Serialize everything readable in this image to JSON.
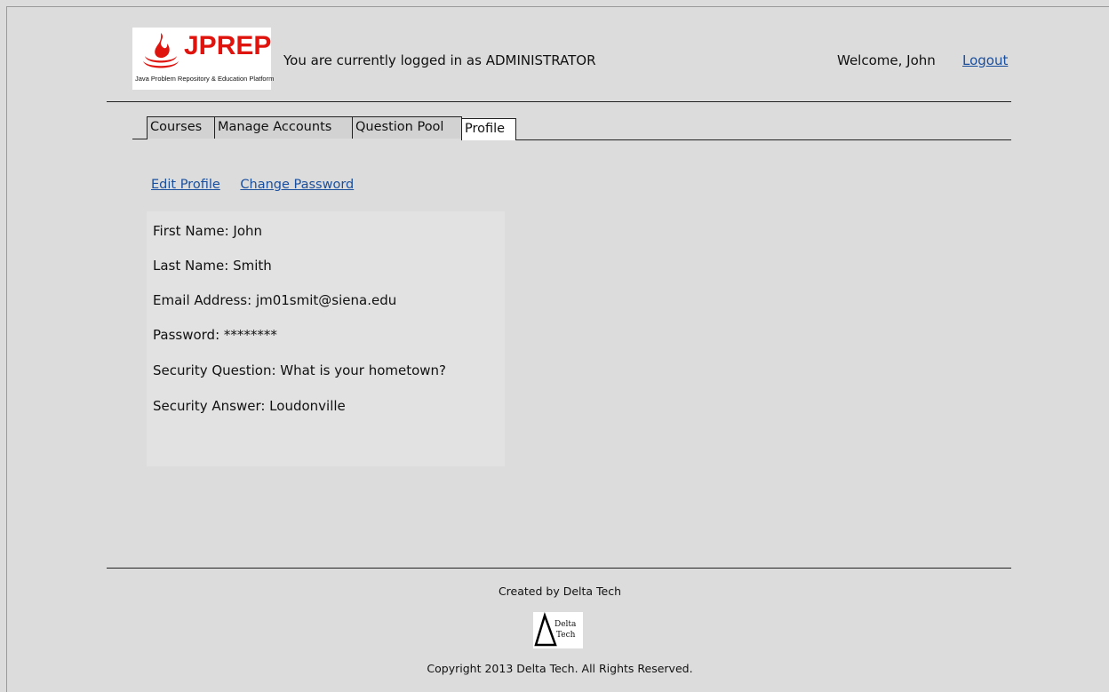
{
  "header": {
    "logo_title": "JPREP",
    "logo_tagline": "Java Problem Repository & Education Platform",
    "logged_in_text": "You are currently logged in as ADMINISTRATOR",
    "welcome_text": "Welcome, John",
    "logout_label": "Logout"
  },
  "tabs": [
    {
      "label": "Courses",
      "active": false
    },
    {
      "label": "Manage Accounts",
      "active": false
    },
    {
      "label": "Question Pool",
      "active": false
    },
    {
      "label": "Profile",
      "active": true
    }
  ],
  "profile_links": {
    "edit_profile": "Edit Profile",
    "change_password": "Change Password"
  },
  "profile": {
    "first_name": "First Name: John",
    "last_name": "Last Name: Smith",
    "email": "Email Address: jm01smit@siena.edu",
    "password": "Password: ********",
    "security_question": "Security Question: What is your hometown?",
    "security_answer": "Security Answer: Loudonville"
  },
  "footer": {
    "created_by": "Created by Delta Tech",
    "company_logo_text_1": "Delta",
    "company_logo_text_2": "Tech",
    "copyright": "Copyright 2013 Delta Tech. All Rights Reserved."
  },
  "colors": {
    "background": "#dcdcdc",
    "link": "#1a4f9e",
    "brand_red": "#e0140f",
    "panel": "#e2e2e2"
  }
}
